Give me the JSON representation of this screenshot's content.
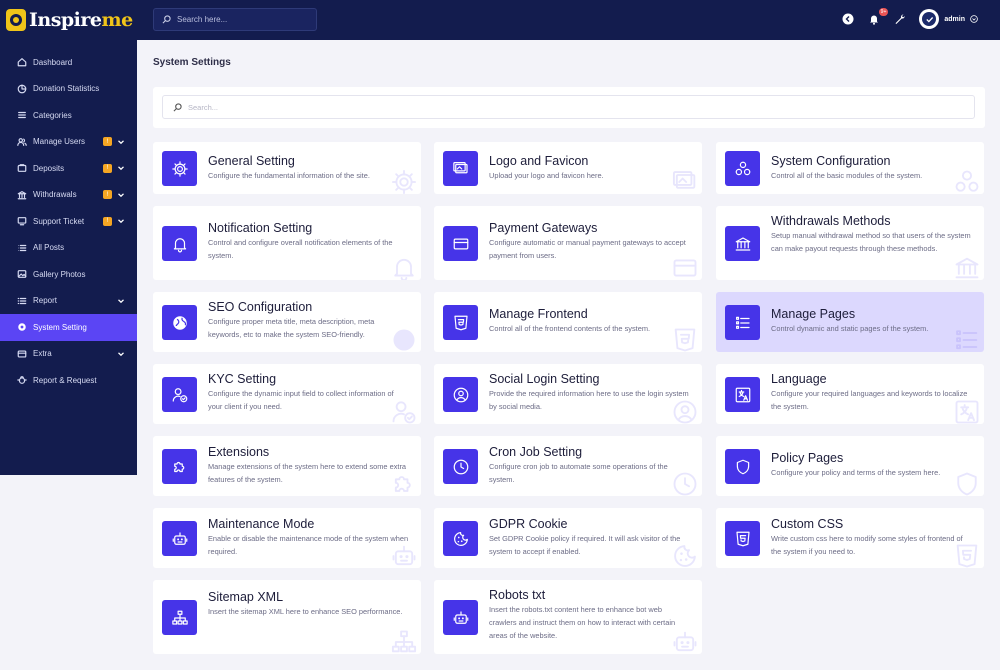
{
  "app": {
    "logo_text_a": "Inspire",
    "logo_text_b": "me"
  },
  "sidebar": {
    "items": [
      {
        "label": "Dashboard",
        "icon": "home-icon",
        "badge": "",
        "has_chevron": false,
        "active": false
      },
      {
        "label": "Donation Statistics",
        "icon": "chart-pie-icon",
        "badge": "",
        "has_chevron": false,
        "active": false
      },
      {
        "label": "Categories",
        "icon": "list-icon",
        "badge": "",
        "has_chevron": false,
        "active": false
      },
      {
        "label": "Manage Users",
        "icon": "users-icon",
        "badge": "!",
        "has_chevron": true,
        "active": false
      },
      {
        "label": "Deposits",
        "icon": "deposit-icon",
        "badge": "!",
        "has_chevron": true,
        "active": false
      },
      {
        "label": "Withdrawals",
        "icon": "bank-icon",
        "badge": "!",
        "has_chevron": true,
        "active": false
      },
      {
        "label": "Support Ticket",
        "icon": "ticket-icon",
        "badge": "!",
        "has_chevron": true,
        "active": false
      },
      {
        "label": "All Posts",
        "icon": "posts-icon",
        "badge": "",
        "has_chevron": false,
        "active": false
      },
      {
        "label": "Gallery Photos",
        "icon": "image-icon",
        "badge": "",
        "has_chevron": false,
        "active": false
      },
      {
        "label": "Report",
        "icon": "report-icon",
        "badge": "",
        "has_chevron": true,
        "active": false
      },
      {
        "label": "System Setting",
        "icon": "gear-icon",
        "badge": "",
        "has_chevron": false,
        "active": true
      },
      {
        "label": "Extra",
        "icon": "extra-icon",
        "badge": "",
        "has_chevron": true,
        "active": false
      },
      {
        "label": "Report & Request",
        "icon": "bug-icon",
        "badge": "",
        "has_chevron": false,
        "active": false
      }
    ]
  },
  "topbar": {
    "search_placeholder": "Search here...",
    "notification_badge": "9+",
    "admin_name": "admin"
  },
  "main": {
    "page_title": "System Settings",
    "search_placeholder": "Search...",
    "cards": [
      {
        "title": "General Setting",
        "desc": "Configure the fundamental information of the site.",
        "icon": "gear-icon"
      },
      {
        "title": "Logo and Favicon",
        "desc": "Upload your logo and favicon here.",
        "icon": "images-icon"
      },
      {
        "title": "System Configuration",
        "desc": "Control all of the basic modules of the system.",
        "icon": "cubes-icon"
      },
      {
        "title": "Notification Setting",
        "desc": "Control and configure overall notification elements of the system.",
        "icon": "bell-icon"
      },
      {
        "title": "Payment Gateways",
        "desc": "Configure automatic or manual payment gateways to accept payment from users.",
        "icon": "credit-card-icon"
      },
      {
        "title": "Withdrawals Methods",
        "desc": "Setup manual withdrawal method so that users of the system can make payout requests through these methods.",
        "icon": "bank-icon"
      },
      {
        "title": "SEO Configuration",
        "desc": "Configure proper meta title, meta description, meta keywords, etc to make the system SEO-friendly.",
        "icon": "globe-icon"
      },
      {
        "title": "Manage Frontend",
        "desc": "Control all of the frontend contents of the system.",
        "icon": "html5-icon"
      },
      {
        "title": "Manage Pages",
        "desc": "Control dynamic and static pages of the system.",
        "icon": "list-icon"
      },
      {
        "title": "KYC Setting",
        "desc": "Configure the dynamic input field to collect information of your client if you need.",
        "icon": "user-check-icon"
      },
      {
        "title": "Social Login Setting",
        "desc": "Provide the required information here to use the login system by social media.",
        "icon": "user-circle-icon"
      },
      {
        "title": "Language",
        "desc": "Configure your required languages and keywords to localize the system.",
        "icon": "language-icon"
      },
      {
        "title": "Extensions",
        "desc": "Manage extensions of the system here to extend some extra features of the system.",
        "icon": "puzzle-icon"
      },
      {
        "title": "Cron Job Setting",
        "desc": "Configure cron job to automate some operations of the system.",
        "icon": "clock-icon"
      },
      {
        "title": "Policy Pages",
        "desc": "Configure your policy and terms of the system here.",
        "icon": "shield-icon"
      },
      {
        "title": "Maintenance Mode",
        "desc": "Enable or disable the maintenance mode of the system when required.",
        "icon": "robot-icon"
      },
      {
        "title": "GDPR Cookie",
        "desc": "Set GDPR Cookie policy if required. It will ask visitor of the system to accept if enabled.",
        "icon": "cookie-icon"
      },
      {
        "title": "Custom CSS",
        "desc": "Write custom css here to modify some styles of frontend of the system if you need to.",
        "icon": "css3-icon"
      },
      {
        "title": "Sitemap XML",
        "desc": "Insert the sitemap XML here to enhance SEO performance.",
        "icon": "sitemap-icon"
      },
      {
        "title": "Robots txt",
        "desc": "Insert the robots.txt content here to enhance bot web crawlers and instruct them on how to interact with certain areas of the website.",
        "icon": "robot-icon"
      }
    ]
  },
  "colors": {
    "sidebar_bg": "#131c4e",
    "accent": "#5b45f4",
    "card_icon_bg": "#4634e8",
    "badge": "#f5a623",
    "highlight_card": "#dcd8fe"
  }
}
